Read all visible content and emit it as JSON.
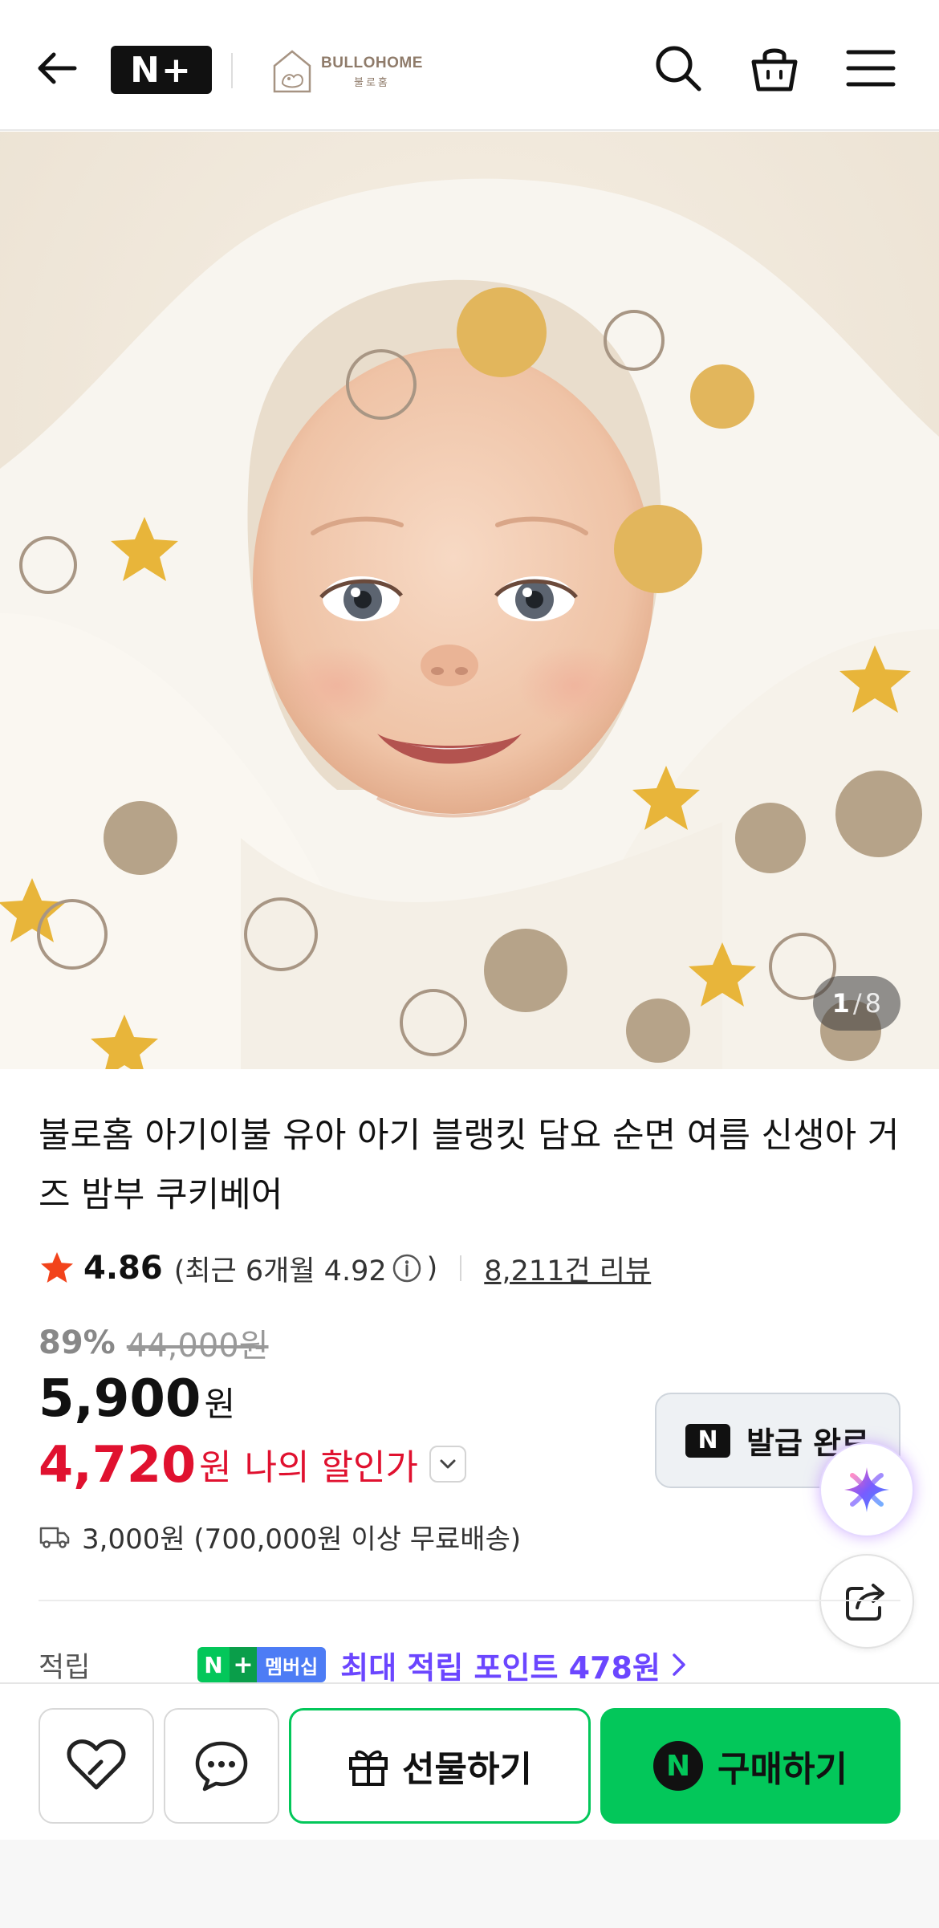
{
  "header": {
    "back_icon": "arrow-left-icon",
    "nplus_label": "N+",
    "brand": {
      "name": "BULLOHOME",
      "sub": "불로홈"
    },
    "search_icon": "search-icon",
    "cart_icon": "shopping-bag-icon",
    "menu_icon": "hamburger-menu-icon"
  },
  "gallery": {
    "current": "1",
    "separator": "/",
    "total": "8"
  },
  "product": {
    "title": "불로홈 아기이불 유아 아기 블랭킷 담요 순면 여름 신생아 거즈 밤부 쿠키베어",
    "rating": "4.86",
    "recent_rating_prefix": "(최근 6개월 4.92",
    "recent_rating_suffix": ")",
    "review_count": "8,211건 리뷰",
    "discount_percent": "89%",
    "original_price": "44,000원",
    "price": "5,900",
    "price_unit": "원",
    "my_price": "4,720",
    "my_price_unit": "원",
    "my_price_label": "나의 할인가",
    "coupon_badge": "N",
    "coupon_label": "발급 완료",
    "shipping": "3,000원 (700,000원 이상 무료배송)",
    "points_label": "적립",
    "membership_n": "N",
    "membership_plus": "+",
    "membership_label": "멤버십",
    "points_text": "최대 적립 포인트 478원"
  },
  "bottom_bar": {
    "gift_label": "선물하기",
    "buy_badge": "N",
    "buy_label": "구매하기"
  },
  "colors": {
    "naver_green": "#03c75a",
    "discount_red": "#e0112f",
    "points_purple": "#6b46ff",
    "star": "#f2431b"
  }
}
